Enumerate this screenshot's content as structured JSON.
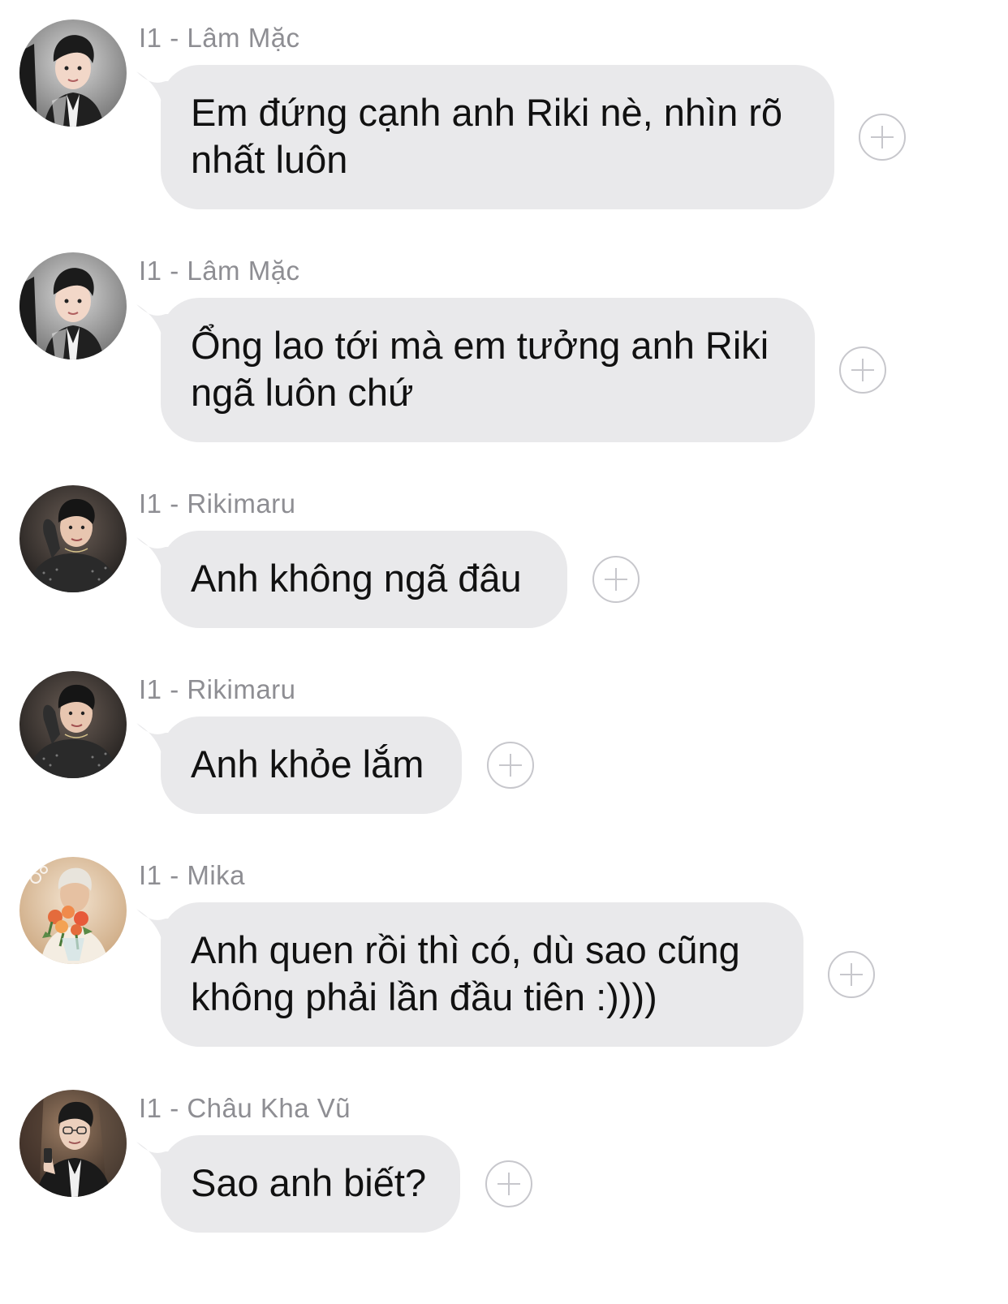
{
  "messages": [
    {
      "sender": "I1 - Lâm Mặc",
      "text": "Em đứng cạnh anh Riki nè, nhìn rõ nhất luôn",
      "avatar": "avatar-lam-mac"
    },
    {
      "sender": "I1 - Lâm Mặc",
      "text": "Ổng lao tới mà em tưởng anh Riki ngã luôn chứ",
      "avatar": "avatar-lam-mac"
    },
    {
      "sender": "I1 - Rikimaru",
      "text": "Anh không ngã đâu",
      "avatar": "avatar-rikimaru"
    },
    {
      "sender": "I1 - Rikimaru",
      "text": "Anh khỏe lắm",
      "avatar": "avatar-rikimaru"
    },
    {
      "sender": "I1 - Mika",
      "text": "Anh quen rồi thì có, dù sao cũng không phải lần đầu tiên :))))",
      "avatar": "avatar-mika"
    },
    {
      "sender": "I1 - Châu Kha Vũ",
      "text": "Sao anh biết?",
      "avatar": "avatar-chau-kha-vu"
    }
  ],
  "icons": {
    "reaction": "plus-circle-icon"
  },
  "colors": {
    "bubble": "#e9e9eb",
    "sender_name": "#8e8e93",
    "text": "#111111",
    "reaction_icon": "#c7c7cc"
  }
}
